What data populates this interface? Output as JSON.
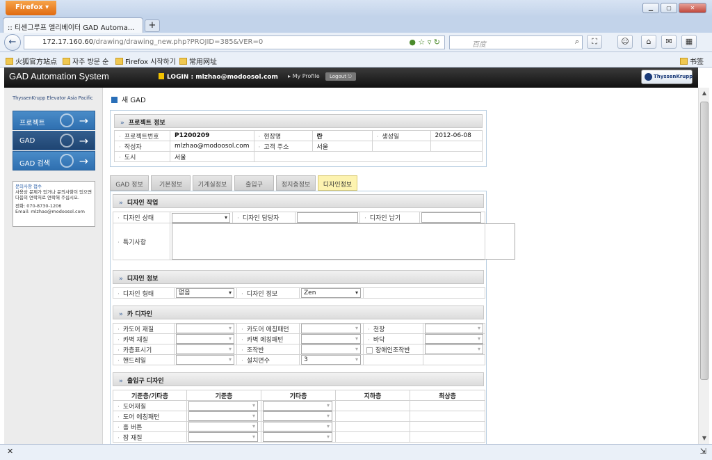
{
  "browser": {
    "app_button": "Firefox",
    "tab_title": ":: 티센그루프 엘리베이터 GAD Automa...",
    "url_host": "172.17.160.60",
    "url_path": "/drawing/drawing_new.php?PROJID=385&VER=0",
    "search_placeholder": "百度",
    "bookmarks": [
      "火狐官方站点",
      "자주 방문 순",
      "Firefox 시작하기",
      "常用网址"
    ],
    "bookmarks_menu": "书签"
  },
  "site": {
    "title": "GAD Automation System",
    "login": "LOGIN : mlzhao@modoosol.com",
    "my_profile": "My Profile",
    "logout": "Logout",
    "logo": "ThyssenKrupp"
  },
  "sidebar": {
    "company": "ThyssenKrupp Elevator Asia Pacific",
    "menu": [
      {
        "label": "프로젝트"
      },
      {
        "label": "GAD"
      },
      {
        "label": "GAD 검색"
      }
    ],
    "info": {
      "title": "문의사항 접수",
      "body": "사용상 문제가 있거나 문의사항이 있으면 다음의 연락처로 연락해 주십시오.",
      "phone": "전화: 070-8730-1206",
      "email": "Email: mlzhao@modoosol.com"
    }
  },
  "page": {
    "title": "새 GAD"
  },
  "project_info": {
    "heading": "프로젝트 정보",
    "project_no_label": "프로젝트번호",
    "project_no": "P1200209",
    "site_label": "현장명",
    "site": "란",
    "created_label": "생성일",
    "created": "2012-06-08",
    "author_label": "작성자",
    "author": "mlzhao@modoosol.com",
    "client_addr_label": "고객 주소",
    "client_addr": "서울",
    "city_label": "도시",
    "city": "서울"
  },
  "tabs": [
    "GAD 정보",
    "기본정보",
    "기계실정보",
    "출입구",
    "정지층정보",
    "디자인정보"
  ],
  "design_work": {
    "heading": "디자인 작업",
    "status_label": "디자인 상태",
    "status": "",
    "owner_label": "디자인 담당자",
    "owner": "",
    "due_label": "디자인 납기",
    "due": "",
    "notes_label": "특기사항",
    "notes": ""
  },
  "design_info": {
    "heading": "디자인 정보",
    "type_label": "디자인 형태",
    "type": "없음",
    "info_label": "디자인 정보",
    "info": "Zen"
  },
  "car_design": {
    "heading": "카 디자인",
    "door_material_label": "카도어 재질",
    "door_etch_label": "카도어 에칭패턴",
    "ceiling_label": "천장",
    "wall_material_label": "카벽 재질",
    "wall_etch_label": "카벽 에칭패턴",
    "floor_label": "바닥",
    "indicator_label": "카층표시기",
    "panel_label": "조작반",
    "disabled_panel_label": "장애인조작반",
    "handrail_label": "핸드레일",
    "install_sides_label": "설치면수",
    "install_sides": "3"
  },
  "entrance_design": {
    "heading": "출입구 디자인",
    "columns": [
      "기준층/기타층",
      "기준층",
      "기타층",
      "지하층",
      "최상층"
    ],
    "rows": [
      "도어재질",
      "도어 에칭패턴",
      "홀 버튼",
      "잠 재질"
    ]
  }
}
